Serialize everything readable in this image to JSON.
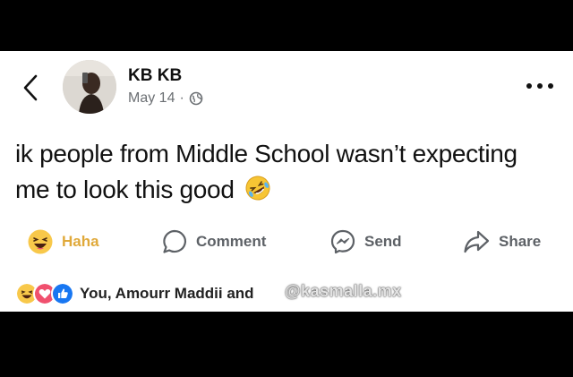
{
  "header": {
    "author_name": "KB KB",
    "date": "May 14",
    "separator": "·",
    "privacy_icon": "globe-icon"
  },
  "post": {
    "text": "ik people from Middle School wasn’t expecting me to look this good",
    "emoji": "rolling-on-floor-laughing-emoji"
  },
  "actions": {
    "haha_label": "Haha",
    "comment_label": "Comment",
    "send_label": "Send",
    "share_label": "Share"
  },
  "reactions": {
    "icons": [
      "haha-icon",
      "love-icon",
      "like-icon"
    ],
    "summary": "You, Amourr Maddii and"
  },
  "watermark": {
    "text": "@kasmalla.mx"
  },
  "colors": {
    "haha_accent": "#e0a93a",
    "like_blue": "#1877f2",
    "love_red": "#f0506e",
    "background": "#000000",
    "card": "#ffffff"
  }
}
